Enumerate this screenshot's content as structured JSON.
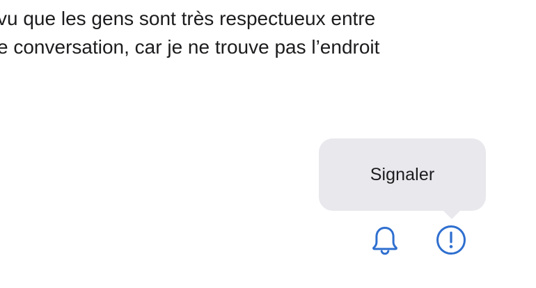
{
  "content": {
    "lines": [
      "vu que les gens sont très respectueux entre",
      "e conversation, car je ne trouve pas l’endroit"
    ]
  },
  "tooltip": {
    "label": "Signaler"
  },
  "actions": {
    "notification_icon": "bell-icon",
    "report_icon": "exclamation-circle-icon"
  },
  "colors": {
    "text": "#1c1c1e",
    "tooltip_background": "#e8e8ed",
    "accent": "#2f6fcf"
  }
}
